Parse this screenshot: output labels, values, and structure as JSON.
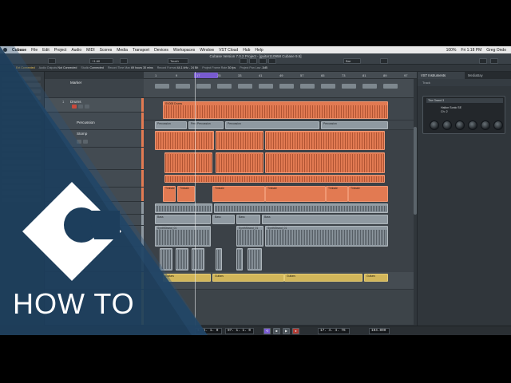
{
  "menubar": {
    "items": [
      "Cubase",
      "File",
      "Edit",
      "Project",
      "Audio",
      "MIDI",
      "Scores",
      "Media",
      "Transport",
      "Devices",
      "Workspaces",
      "Window",
      "VST Cloud",
      "Hub",
      "Help"
    ],
    "right": [
      "100%",
      "Fri 1:18 PM",
      "Greg Ondo"
    ]
  },
  "window": {
    "title": "Cubase Version 7.0.2 Project - [guitar110958 Cubase 9.5]"
  },
  "toolbar": {
    "touch_label": "Touch",
    "preset_label": "+1 All",
    "snap_label": "Bar"
  },
  "statusline": [
    {
      "label": "Ext Connected",
      "value": ""
    },
    {
      "label": "Audio Outputs",
      "value": "Not Connected"
    },
    {
      "label": "Studio",
      "value": "Connected"
    },
    {
      "label": "Record Time Max",
      "value": "69 hours 30 mins"
    },
    {
      "label": "Record Format",
      "value": "44.1 kHz - 24 Bit"
    },
    {
      "label": "Project Frame Rate",
      "value": "30 fps"
    },
    {
      "label": "Project Pan Law",
      "value": "-3dB"
    }
  ],
  "tracks": [
    {
      "num": "",
      "name": "Marker",
      "type": "marker"
    },
    {
      "num": "1",
      "name": "Drums",
      "type": "folder"
    },
    {
      "num": "",
      "name": "Percussion",
      "type": "track"
    },
    {
      "num": "",
      "name": "Stomp",
      "type": "track"
    }
  ],
  "ruler": {
    "ticks": [
      "1",
      "9",
      "17",
      "25",
      "33",
      "41",
      "49",
      "57",
      "65",
      "73",
      "81",
      "89",
      "97"
    ]
  },
  "clips": {
    "drums": "SV008 Drums",
    "percussion_a": "Percussion",
    "percussion_b": "Perc Percussion",
    "timbale": "Timbale",
    "bass": "Bass",
    "synth": "SynthStrand_01",
    "guitars": "Guitars"
  },
  "rightzone": {
    "tabs": [
      "VST Instruments",
      "MediaBay"
    ],
    "toolbar_label": "Track",
    "rack_title": "The Grand 3",
    "instrument_name": "Halion Sonic SE",
    "instrument_sub": "Ch: 2"
  },
  "transport": {
    "left_position": "1. 1. 1. 0",
    "right_position": "97. 1. 1. 0",
    "time_display": "17. 4. 4. 76",
    "tempo": "104.000"
  },
  "overlay": {
    "howto_text": "HOW TO",
    "logo_colors": {
      "background": "#1d3e5c",
      "mark": "#ffffff"
    }
  }
}
